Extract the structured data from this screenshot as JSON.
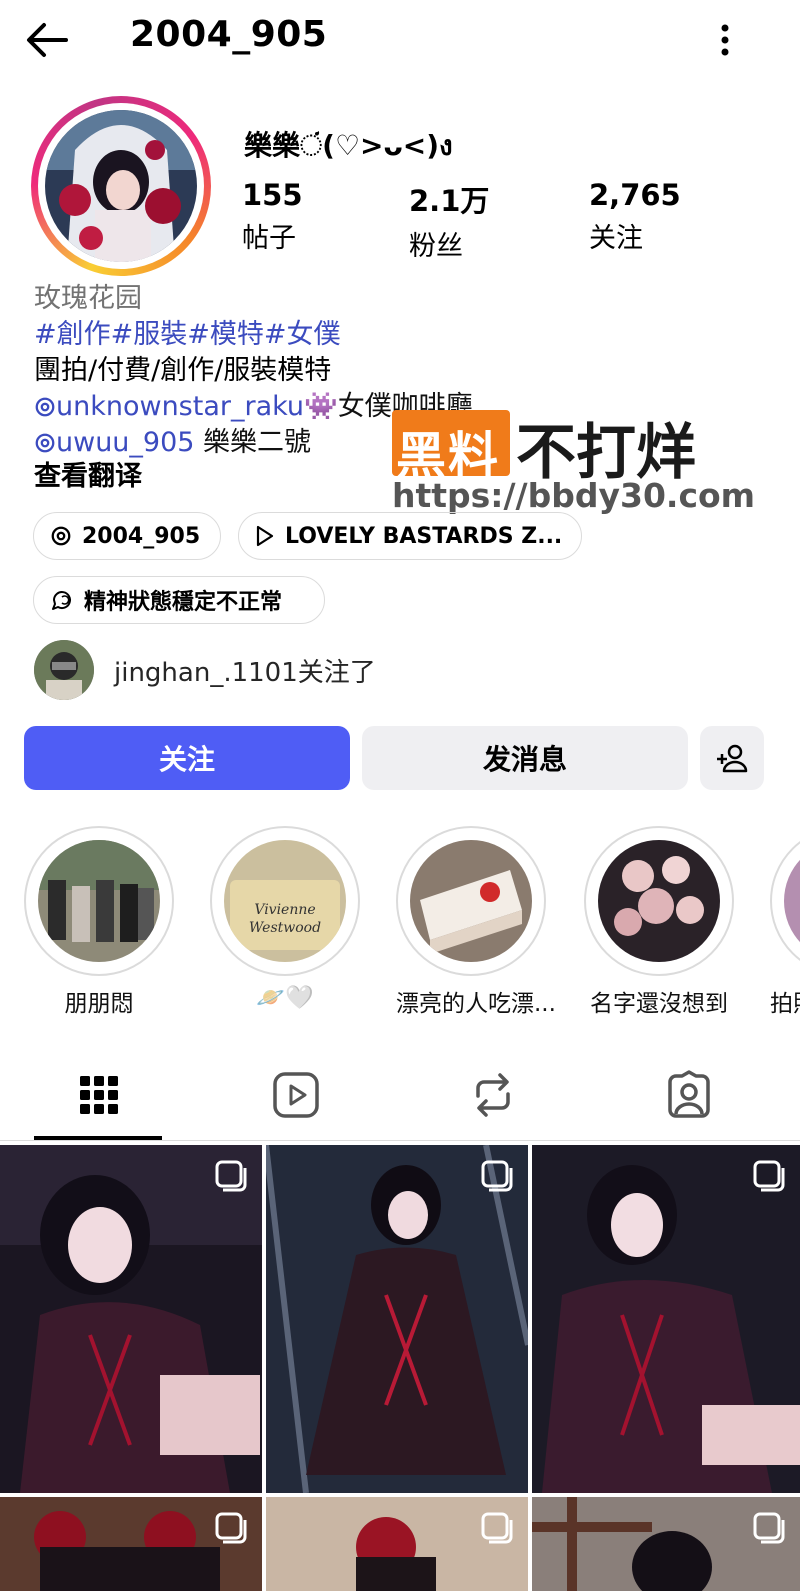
{
  "header": {
    "username": "2004_905",
    "back_icon": "arrow-left-icon",
    "more_icon": "more-vertical-icon"
  },
  "profile": {
    "display_name": "樂樂ં(♡>ᴗ<)ง",
    "stats": [
      {
        "count": "155",
        "label": "帖子"
      },
      {
        "count": "2.1万",
        "label": "粉丝"
      },
      {
        "count": "2,765",
        "label": "关注"
      }
    ],
    "category": "玫瑰花园",
    "hashtags": "#創作#服裝#模特#女僕",
    "bio_line": "團拍/付費/創作/服裝模特",
    "mention1": {
      "handle": "unknownstar_raku",
      "emoji": "👾",
      "text": "女僕咖啡廳"
    },
    "mention2": {
      "handle": "uwuu_905",
      "text": " 樂樂二號"
    },
    "see_translation": "查看翻译"
  },
  "watermark": {
    "badge": "黑料",
    "text": "不打烊",
    "url": "https://bbdy30.com"
  },
  "chips": [
    {
      "label": "2004_905",
      "icon": "threads-icon"
    },
    {
      "label": "LOVELY BASTARDS Z...",
      "icon": "play-icon"
    },
    {
      "label": "精神狀態穩定不正常",
      "icon": "chat-bubble-icon"
    }
  ],
  "followed_by": "jinghan_.1101关注了",
  "buttons": {
    "follow": "关注",
    "message": "发消息",
    "add_user_icon": "add-person-icon"
  },
  "highlights": [
    {
      "label": "朋朋悶"
    },
    {
      "label": "🪐🤍"
    },
    {
      "label": "漂亮的人吃漂..."
    },
    {
      "label": "名字還沒想到"
    },
    {
      "label": "拍照"
    }
  ],
  "tabs": [
    {
      "name": "posts-grid",
      "icon": "grid-icon",
      "active": true
    },
    {
      "name": "reels",
      "icon": "reels-icon",
      "active": false
    },
    {
      "name": "reposts",
      "icon": "repost-icon",
      "active": false
    },
    {
      "name": "tagged",
      "icon": "tagged-user-icon",
      "active": false
    }
  ],
  "colors": {
    "accent": "#4f5df5",
    "link": "#3b4bbf",
    "watermark_orange": "#f07b1a"
  }
}
